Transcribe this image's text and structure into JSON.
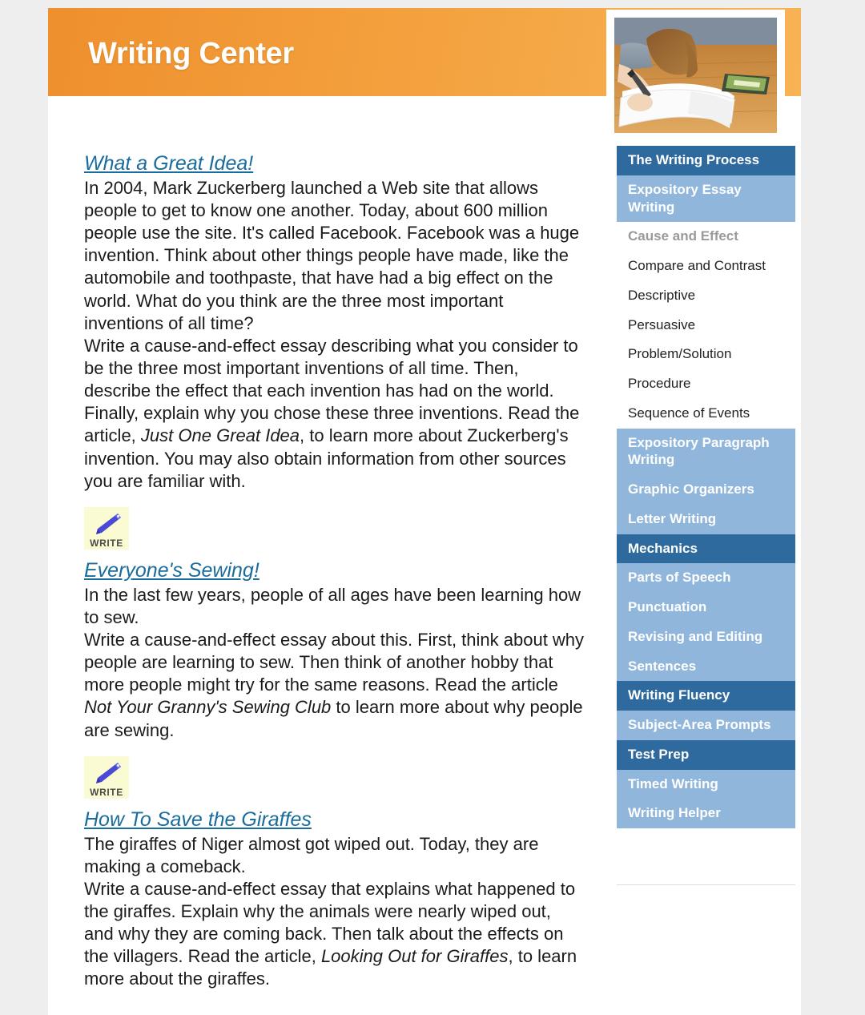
{
  "header": {
    "title": "Writing Center"
  },
  "photo": {
    "alt": "girl-writing-in-notebook"
  },
  "sidebar": {
    "items": [
      {
        "label": "The Writing Process",
        "style": "dark"
      },
      {
        "label": "Expository Essay Writing",
        "style": "light"
      },
      {
        "label": "Cause and Effect",
        "style": "current"
      },
      {
        "label": "Compare and Contrast",
        "style": "plain"
      },
      {
        "label": "Descriptive",
        "style": "plain"
      },
      {
        "label": "Persuasive",
        "style": "plain"
      },
      {
        "label": "Problem/Solution",
        "style": "plain"
      },
      {
        "label": "Procedure",
        "style": "plain"
      },
      {
        "label": "Sequence of Events",
        "style": "plain"
      },
      {
        "label": "Expository Paragraph Writing",
        "style": "light"
      },
      {
        "label": "Graphic Organizers",
        "style": "light"
      },
      {
        "label": "Letter Writing",
        "style": "light"
      },
      {
        "label": "Mechanics",
        "style": "dark"
      },
      {
        "label": "Parts of Speech",
        "style": "light"
      },
      {
        "label": "Punctuation",
        "style": "light"
      },
      {
        "label": "Revising and Editing",
        "style": "light"
      },
      {
        "label": "Sentences",
        "style": "light"
      },
      {
        "label": "Writing Fluency",
        "style": "dark"
      },
      {
        "label": "Subject-Area Prompts",
        "style": "light"
      },
      {
        "label": "Test Prep",
        "style": "dark"
      },
      {
        "label": "Timed Writing",
        "style": "light"
      },
      {
        "label": "Writing Helper",
        "style": "light"
      }
    ]
  },
  "main": {
    "entries": [
      {
        "title": "What a Great Idea!",
        "intro": "In 2004, Mark Zuckerberg launched a Web site that allows people to get to know one another. Today, about 600 million people use the site. It's called Facebook. Facebook was a huge invention. Think about other things people have made, like the automobile and toothpaste, that have had a big effect on the world. What do you think are the three most important inventions of all time?",
        "prompt_before": "Write a cause-and-effect essay describing what you consider to be the three most important inventions of all time. Then, describe the effect that each invention has had on the world. Finally, explain why you chose these three inventions. Read the article, ",
        "article": "Just One Great Idea",
        "prompt_after": ", to learn more about Zuckerberg's invention. You may also obtain information from other sources you are familiar with.",
        "write_label": "WRITE"
      },
      {
        "title": "Everyone's Sewing!",
        "intro": "In the last few years, people of all ages have been learning how to sew.",
        "prompt_before": "Write a cause-and-effect essay about this. First, think about why people are learning to sew. Then think of another hobby that more people might try for the same reasons. Read the article ",
        "article": "Not Your Granny's Sewing Club",
        "prompt_after": " to learn more about why people are sewing.",
        "write_label": "WRITE"
      },
      {
        "title": "How To Save the Giraffes",
        "intro": "The giraffes of Niger almost got wiped out. Today, they are making a comeback.",
        "prompt_before": "Write a cause-and-effect essay that explains what happened to the giraffes. Explain why the animals were nearly wiped out, and why they are coming back. Then talk about the effects on the villagers. Read the article, ",
        "article": "Looking Out for Giraffes",
        "prompt_after": ", to learn more about the giraffes.",
        "write_label": "WRITE"
      }
    ]
  },
  "colors": {
    "banner_start": "#ef8f2d",
    "banner_end": "#f8b355",
    "nav_dark": "#2f6a9e",
    "nav_light": "#91b6dc",
    "link": "#1a6c9c",
    "write_bg": "#fbfbd3",
    "pencil": "#4a4ad6"
  }
}
